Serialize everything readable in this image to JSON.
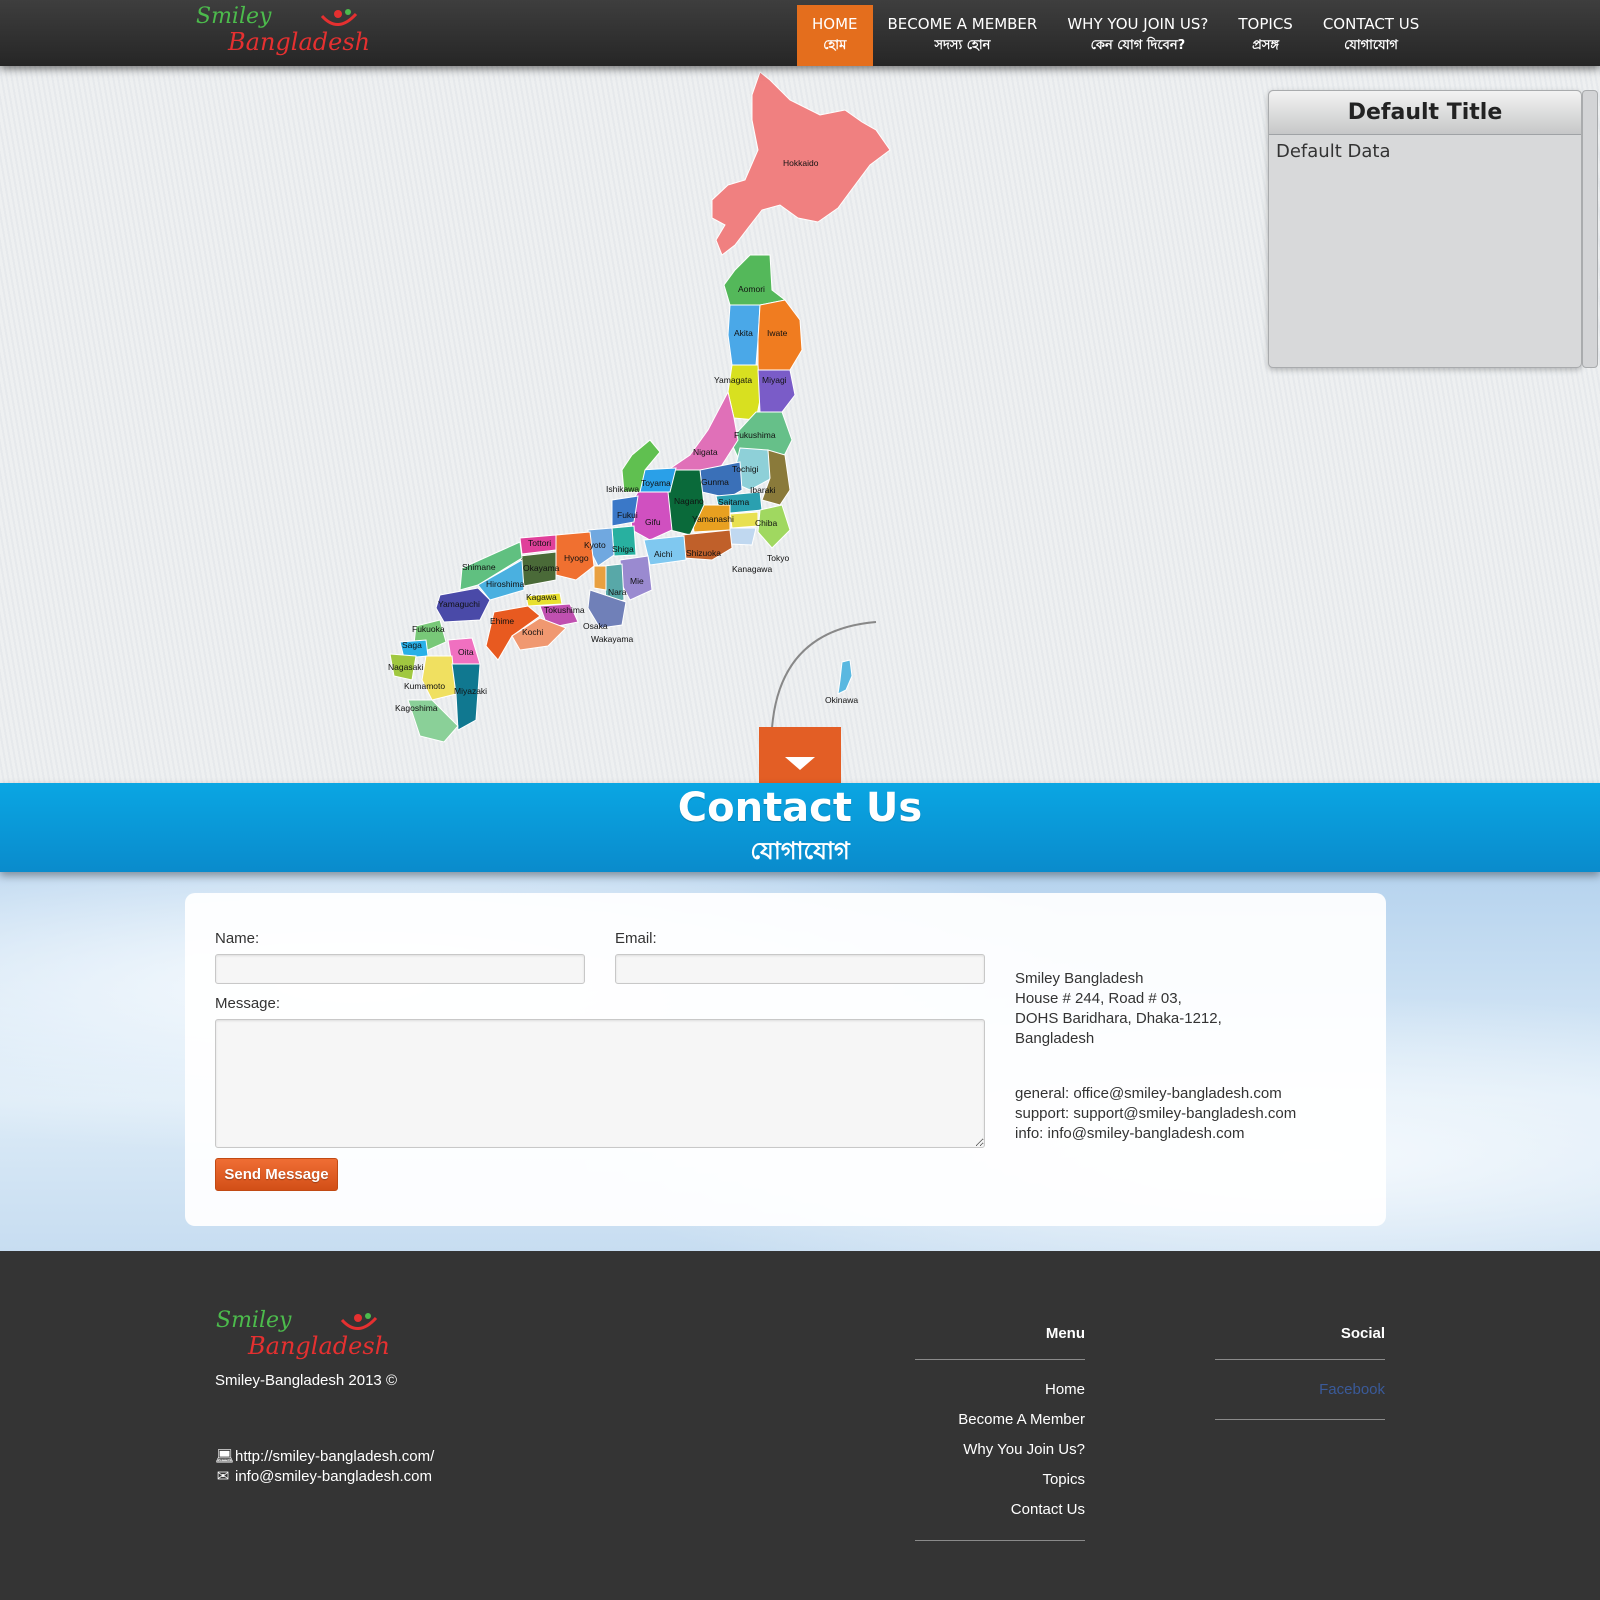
{
  "logo": {
    "line1": "Smiley",
    "line2": "Bangladesh"
  },
  "nav": [
    {
      "en": "HOME",
      "bn": "হোম",
      "active": true
    },
    {
      "en": "BECOME A MEMBER",
      "bn": "সদস্য হোন",
      "active": false
    },
    {
      "en": "WHY YOU JOIN US?",
      "bn": "কেন যোগ দিবেন?",
      "active": false
    },
    {
      "en": "TOPICS",
      "bn": "প্রসঙ্গ",
      "active": false
    },
    {
      "en": "CONTACT US",
      "bn": "যোগাযোগ",
      "active": false
    }
  ],
  "info_panel": {
    "title": "Default Title",
    "body": "Default Data"
  },
  "map": {
    "regions": [
      "Hokkaido",
      "Aomori",
      "Akita",
      "Iwate",
      "Yamagata",
      "Miyagi",
      "Fukushima",
      "Nigata",
      "Tochigi",
      "Toyama",
      "Gunma",
      "Ibaraki",
      "Ishikawa",
      "Nagano",
      "Saitama",
      "Fukui",
      "Gifu",
      "Yamanashi",
      "Chiba",
      "Tottori",
      "Kyoto",
      "Shiga",
      "Aichi",
      "Shizuoka",
      "Tokyo",
      "Hyogo",
      "Kanagawa",
      "Shimane",
      "Okayama",
      "Hiroshima",
      "Mie",
      "Kagawa",
      "Nara",
      "Yamaguchi",
      "Tokushima",
      "Ehime",
      "Osaka",
      "Fukuoka",
      "Kochi",
      "Wakayama",
      "Saga",
      "Oita",
      "Nagasaki",
      "Kumamoto",
      "Miyazaki",
      "Kagoshima",
      "Okinawa"
    ]
  },
  "contact_banner": {
    "title": "Contact Us",
    "subtitle": "যোগাযোগ"
  },
  "form": {
    "name_label": "Name:",
    "email_label": "Email:",
    "message_label": "Message:",
    "name_value": "",
    "email_value": "",
    "message_value": "",
    "send_label": "Send Message"
  },
  "address": {
    "lines": [
      "Smiley Bangladesh",
      "House # 244, Road # 03,",
      "DOHS Baridhara, Dhaka-1212,",
      "Bangladesh"
    ],
    "emails": [
      "general: office@smiley-bangladesh.com",
      "support: support@smiley-bangladesh.com",
      "info: info@smiley-bangladesh.com"
    ]
  },
  "footer": {
    "copyright": "Smiley-Bangladesh 2013 ©",
    "website": "http://smiley-bangladesh.com/",
    "email": "info@smiley-bangladesh.com",
    "menu_title": "Menu",
    "menu": [
      "Home",
      "Become A Member",
      "Why You Join Us?",
      "Topics",
      "Contact Us"
    ],
    "social_title": "Social",
    "social": [
      "Facebook"
    ]
  },
  "colors": {
    "accent": "#e46e1d",
    "banner": "#0a9ad8",
    "footer": "#343434",
    "link_social": "#3a5a99"
  }
}
